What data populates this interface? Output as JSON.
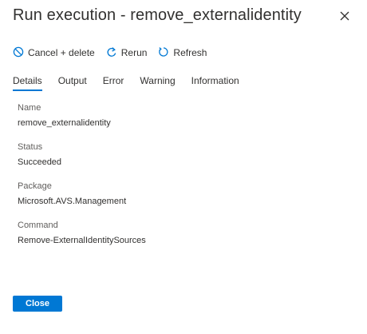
{
  "panel": {
    "title": "Run execution - remove_externalidentity"
  },
  "toolbar": {
    "cancel_delete_label": "Cancel + delete",
    "rerun_label": "Rerun",
    "refresh_label": "Refresh"
  },
  "tabs": [
    {
      "label": "Details",
      "active": true
    },
    {
      "label": "Output",
      "active": false
    },
    {
      "label": "Error",
      "active": false
    },
    {
      "label": "Warning",
      "active": false
    },
    {
      "label": "Information",
      "active": false
    }
  ],
  "details": [
    {
      "label": "Name",
      "value": "remove_externalidentity"
    },
    {
      "label": "Status",
      "value": "Succeeded"
    },
    {
      "label": "Package",
      "value": "Microsoft.AVS.Management"
    },
    {
      "label": "Command",
      "value": "Remove-ExternalIdentitySources"
    }
  ],
  "footer": {
    "close_label": "Close"
  },
  "colors": {
    "accent": "#0078d4",
    "text": "#323130",
    "secondary_text": "#605e5c"
  },
  "icons": {
    "cancel": "prohibited-icon",
    "rerun": "rerun-icon",
    "refresh": "refresh-icon",
    "close": "close-icon"
  }
}
